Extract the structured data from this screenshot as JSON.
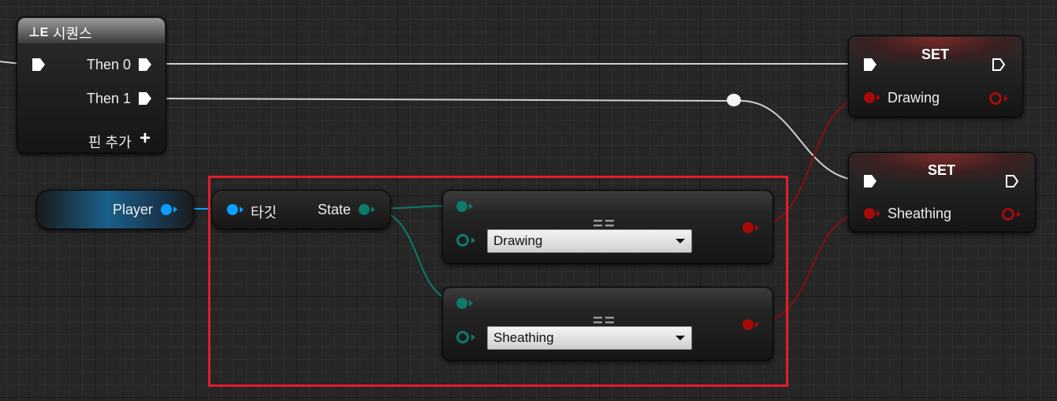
{
  "sequence_node": {
    "title": "시퀀스",
    "outputs": [
      "Then 0",
      "Then 1"
    ],
    "add_pin_label": "핀 추가",
    "icon": "sequence-icon"
  },
  "player_node": {
    "label": "Player"
  },
  "get_state_node": {
    "target_label": "타깃",
    "output_label": "State"
  },
  "compare_nodes": [
    {
      "operator": "==",
      "value": "Drawing"
    },
    {
      "operator": "==",
      "value": "Sheathing"
    }
  ],
  "set_nodes": [
    {
      "title": "SET",
      "variable": "Drawing"
    },
    {
      "title": "SET",
      "variable": "Sheathing"
    }
  ],
  "colors": {
    "exec_wire": "#cfcfcf",
    "object_pin": "#0aa0ff",
    "byte_pin": "#0e7a6a",
    "bool_pin": "#a80a0a",
    "highlight": "#e01e2a"
  }
}
